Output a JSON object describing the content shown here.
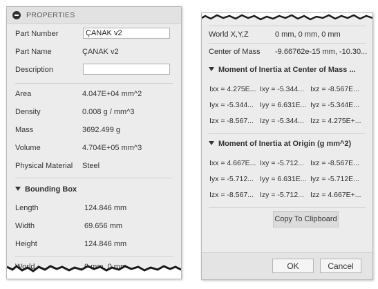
{
  "left": {
    "title": "PROPERTIES",
    "part_number": {
      "label": "Part Number",
      "value": "ÇANAK v2"
    },
    "part_name": {
      "label": "Part Name",
      "value": "ÇANAK v2"
    },
    "description": {
      "label": "Description",
      "value": ""
    },
    "area": {
      "label": "Area",
      "value": "4.047E+04 mm^2"
    },
    "density": {
      "label": "Density",
      "value": "0.008 g / mm^3"
    },
    "mass": {
      "label": "Mass",
      "value": "3692.499 g"
    },
    "volume": {
      "label": "Volume",
      "value": "4.704E+05 mm^3"
    },
    "material": {
      "label": "Physical Material",
      "value": "Steel"
    },
    "bounding_box": {
      "title": "Bounding Box",
      "length": {
        "label": "Length",
        "value": "124.846 mm"
      },
      "width": {
        "label": "Width",
        "value": "69.656 mm"
      },
      "height": {
        "label": "Height",
        "value": "124.846 mm"
      }
    },
    "partial_row": {
      "label": "World",
      "value": "0 mm, 0 mm"
    }
  },
  "right": {
    "world_xyz": {
      "label": "World X,Y,Z",
      "value": "0 mm, 0 mm, 0 mm"
    },
    "center_of_mass": {
      "label": "Center of Mass",
      "value": "-9.66762e-15 mm, -10.30..."
    },
    "moi_center": {
      "title": "Moment of Inertia at Center of Mass ...",
      "rows": [
        [
          "Ixx = 4.275E...",
          "Ixy = -5.344...",
          "Ixz = -8.567E..."
        ],
        [
          "Iyx = -5.344...",
          "Iyy = 6.631E...",
          "Iyz = -5.344E..."
        ],
        [
          "Izx = -8.567...",
          "Izy = -5.344...",
          "Izz = 4.275E+..."
        ]
      ]
    },
    "moi_origin": {
      "title": "Moment of Inertia at Origin  (g mm^2)",
      "rows": [
        [
          "Ixx = 4.667E...",
          "Ixy = -5.712...",
          "Ixz = -8.567E..."
        ],
        [
          "Iyx = -5.712...",
          "Iyy = 6.631E...",
          "Iyz = -5.712E..."
        ],
        [
          "Izx = -8.567...",
          "Izy = -5.712...",
          "Izz = 4.667E+..."
        ]
      ]
    },
    "copy_button": "Copy To Clipboard",
    "ok_button": "OK",
    "cancel_button": "Cancel"
  },
  "colors": {
    "panel_bg": "#ececec",
    "title_bg": "#e2e2e2",
    "icon": "#2f2f2f"
  }
}
